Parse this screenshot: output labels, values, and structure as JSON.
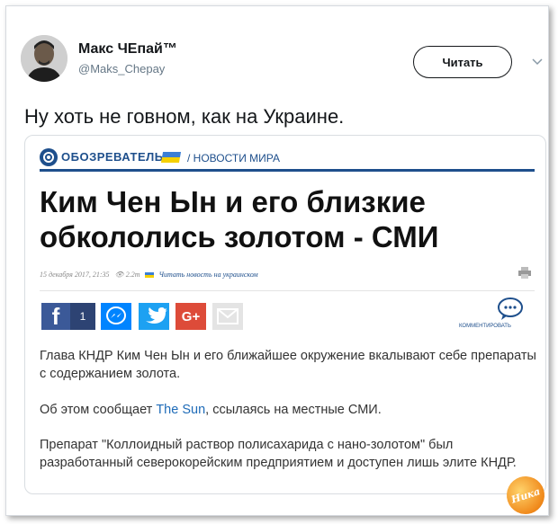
{
  "author": {
    "display_name": "Макс ЧЕпай™",
    "handle": "@Maks_Chepay"
  },
  "follow_label": "Читать",
  "tweet_text": "Ну хоть не говном, как на Украине.",
  "article": {
    "site_name": "ОБОЗРЕВАТЕЛЬ",
    "section": "/ НОВОСТИ МИРА",
    "headline": "Ким Чен Ын и его близкие обкололись золотом - СМИ",
    "date": "15 декабря 2017, 21:35",
    "views": "2.2т",
    "ua_link": "Читать новость на украинском",
    "share_count": "1",
    "comment_label": "КОММЕНТИРОВАТЬ",
    "paragraph1": "Глава КНДР Ким Чен Ын и его ближайшее окружение вкалывают себе препараты с содержанием золота.",
    "paragraph2_before": "Об этом сообщает ",
    "paragraph2_link": "The Sun",
    "paragraph2_after": ", ссылаясь на местные СМИ.",
    "paragraph3": "Препарат \"Коллоидный раствор полисахарида с нано-золотом\" был разработанный северокорейским предприятием и доступен лишь элите КНДР."
  },
  "watermark": "Ника",
  "colors": {
    "brand_blue": "#1e4f8c",
    "facebook": "#3b5998",
    "messenger": "#0084ff",
    "twitter": "#1da1f2",
    "google_plus": "#dd4b39"
  }
}
